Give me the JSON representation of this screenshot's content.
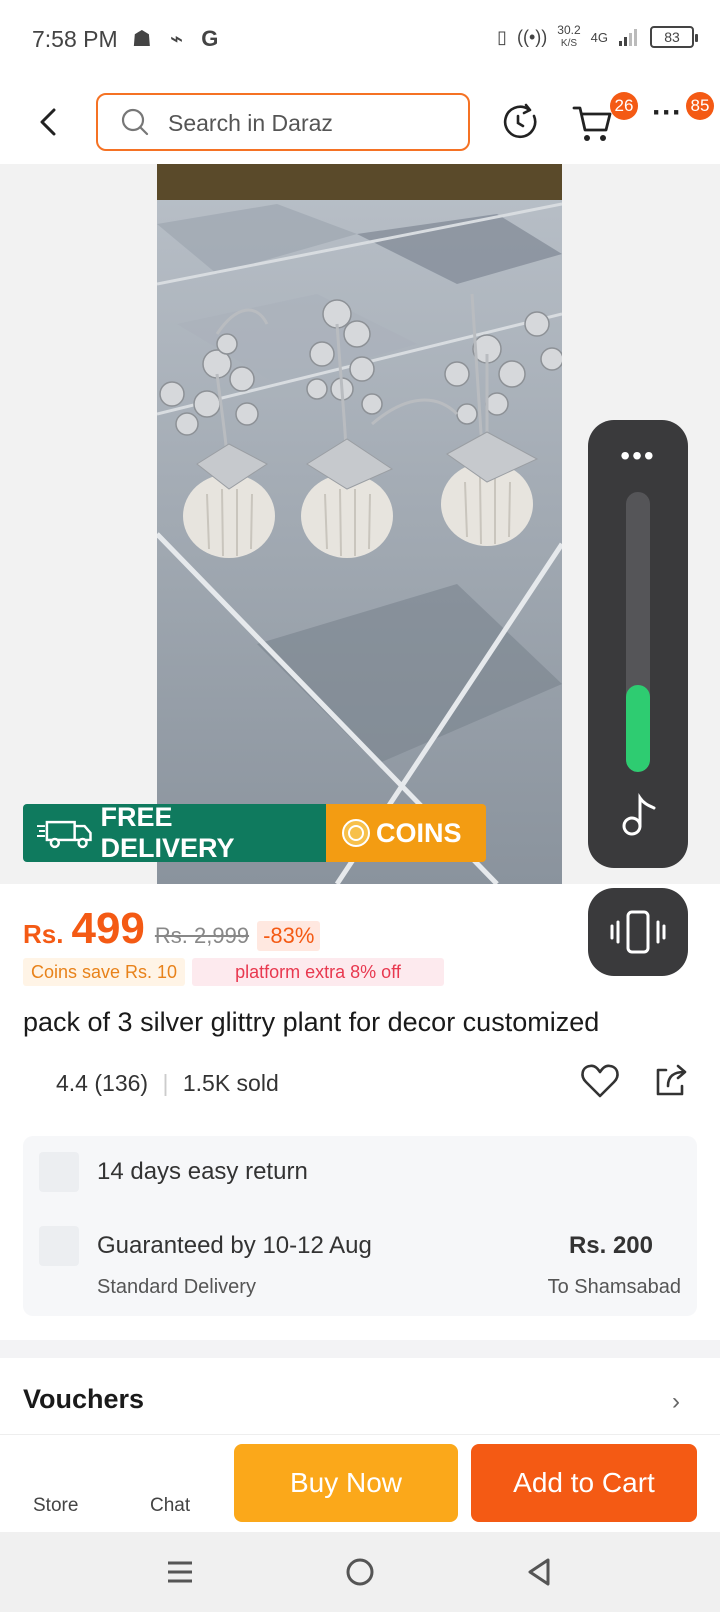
{
  "status": {
    "time": "7:58 PM",
    "left_icons": "☗ ⌁ G",
    "speed": "30.2",
    "speed_unit": "K/S",
    "network": "4G",
    "battery": "83"
  },
  "header": {
    "search_placeholder": "Search in Daraz",
    "cart_badge": "26",
    "more_badge": "85"
  },
  "promo": {
    "free_delivery": "FREE DELIVERY",
    "coins": "COINS"
  },
  "volume": {
    "level": 0.31
  },
  "price": {
    "currency": "Rs.",
    "current": "499",
    "original": "Rs. 2,999",
    "discount": "-83%",
    "coins_tag": "Coins save Rs. 10",
    "platform_tag": "platform extra 8% off"
  },
  "product": {
    "title": "pack of 3 silver glittry plant for decor customized",
    "rating": "4.4",
    "reviews": "(136)",
    "sold": "1.5K sold"
  },
  "info": {
    "return_text": "14 days easy return",
    "delivery_text": "Guaranteed by 10-12 Aug",
    "delivery_type": "Standard Delivery",
    "delivery_price": "Rs. 200",
    "delivery_to": "To Shamsabad"
  },
  "vouchers": {
    "label": "Vouchers"
  },
  "bottom": {
    "store": "Store",
    "chat": "Chat",
    "buy_now": "Buy Now",
    "add_to_cart": "Add to Cart"
  },
  "colors": {
    "brand": "#f45a14",
    "buy_now": "#fba81a",
    "free_delivery": "#0f7a5e",
    "volume_fill": "#2ecc71"
  }
}
